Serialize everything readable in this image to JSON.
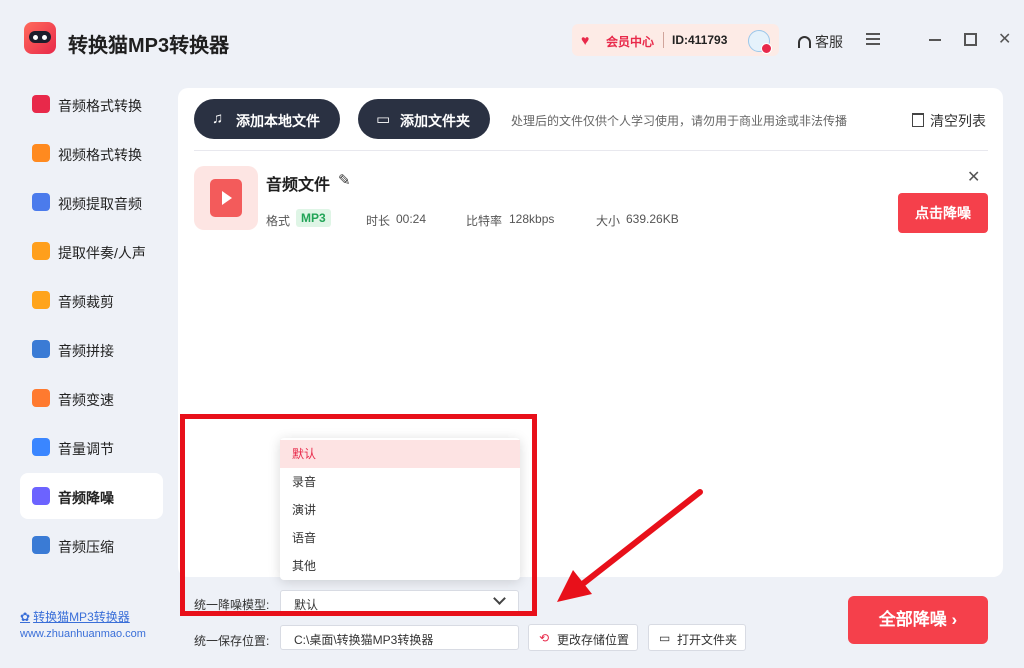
{
  "app": {
    "title": "转换猫MP3转换器",
    "logo_text": "转换猫"
  },
  "header": {
    "member_center": "会员中心",
    "user_id": "ID:411793",
    "service": "客服"
  },
  "sidebar": {
    "items": [
      {
        "label": "音频格式转换",
        "icon": "audio-format-icon",
        "color": "#e8294a"
      },
      {
        "label": "视频格式转换",
        "icon": "video-format-icon",
        "color": "#ff8a1f"
      },
      {
        "label": "视频提取音频",
        "icon": "extract-audio-icon",
        "color": "#4b7bec"
      },
      {
        "label": "提取伴奏/人声",
        "icon": "vocal-icon",
        "color": "#ff9f1c"
      },
      {
        "label": "音频裁剪",
        "icon": "cut-icon",
        "color": "#ffa41b"
      },
      {
        "label": "音频拼接",
        "icon": "merge-icon",
        "color": "#3a7bd5"
      },
      {
        "label": "音频变速",
        "icon": "speed-icon",
        "color": "#ff7a2f"
      },
      {
        "label": "音量调节",
        "icon": "volume-icon",
        "color": "#3a86ff"
      },
      {
        "label": "音频降噪",
        "icon": "denoise-icon",
        "color": "#6c63ff"
      },
      {
        "label": "音频压缩",
        "icon": "compress-icon",
        "color": "#3a7bd5"
      }
    ],
    "active_index": 8,
    "footer_link": "转换猫MP3转换器",
    "footer_url": "www.zhuanhuanmao.com"
  },
  "toolbar": {
    "add_file": "添加本地文件",
    "add_folder": "添加文件夹",
    "notice": "处理后的文件仅供个人学习使用，请勿用于商业用途或非法传播",
    "clear_list": "清空列表"
  },
  "file": {
    "name": "音频文件",
    "format_label": "格式",
    "format": "MP3",
    "duration_label": "时长",
    "duration": "00:24",
    "bitrate_label": "比特率",
    "bitrate": "128kbps",
    "size_label": "大小",
    "size": "639.26KB",
    "action": "点击降噪"
  },
  "dropdown": {
    "options": [
      "默认",
      "录音",
      "演讲",
      "语音",
      "其他"
    ],
    "selected_index": 0
  },
  "bottom": {
    "model_label": "统一降噪模型:",
    "model_value": "默认",
    "save_label": "统一保存位置:",
    "save_path": "C:\\桌面\\转换猫MP3转换器",
    "change_location": "更改存储位置",
    "open_folder": "打开文件夹",
    "all_action": "全部降噪"
  },
  "colors": {
    "accent": "#f5404b",
    "highlight": "#e8101a",
    "dark_button": "#2a3142"
  }
}
